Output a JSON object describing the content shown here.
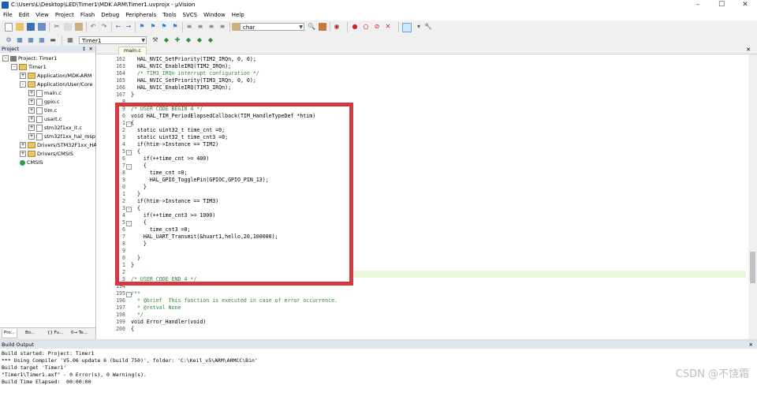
{
  "window": {
    "title": "C:\\Users\\L\\Desktop\\LED\\Timer1\\MDK ARM\\Timer1.uvprojx - µVision"
  },
  "menu": [
    "File",
    "Edit",
    "View",
    "Project",
    "Flash",
    "Debug",
    "Peripherals",
    "Tools",
    "SVCS",
    "Window",
    "Help"
  ],
  "toolbar": {
    "find_value": "char",
    "target_value": "Timer1"
  },
  "project_panel": {
    "header": "Project",
    "tree": [
      {
        "label": "Project: Timer1",
        "indent": 0,
        "kind": "project",
        "toggle": "-"
      },
      {
        "label": "Timer1",
        "indent": 1,
        "kind": "target",
        "toggle": "-"
      },
      {
        "label": "Application/MDK-ARM",
        "indent": 2,
        "kind": "folder",
        "toggle": "+"
      },
      {
        "label": "Application/User/Core",
        "indent": 2,
        "kind": "folder",
        "toggle": "-"
      },
      {
        "label": "main.c",
        "indent": 3,
        "kind": "file",
        "toggle": "+"
      },
      {
        "label": "gpio.c",
        "indent": 3,
        "kind": "file",
        "toggle": "+"
      },
      {
        "label": "tim.c",
        "indent": 3,
        "kind": "file",
        "toggle": "+"
      },
      {
        "label": "usart.c",
        "indent": 3,
        "kind": "file",
        "toggle": "+"
      },
      {
        "label": "stm32f1xx_it.c",
        "indent": 3,
        "kind": "file",
        "toggle": "+"
      },
      {
        "label": "stm32f1xx_hal_msp",
        "indent": 3,
        "kind": "file",
        "toggle": "+"
      },
      {
        "label": "Drivers/STM32F1xx_HAL",
        "indent": 2,
        "kind": "folder",
        "toggle": "+"
      },
      {
        "label": "Drivers/CMSIS",
        "indent": 2,
        "kind": "folder",
        "toggle": "+"
      },
      {
        "label": "CMSIS",
        "indent": 2,
        "kind": "gear",
        "toggle": ""
      }
    ],
    "tabs": [
      "Pro...",
      "Bo...",
      "{} Fu...",
      "0→ Te..."
    ]
  },
  "editor": {
    "tab": "main.c",
    "lines": [
      {
        "n": "162",
        "code": "  HAL_NVIC_SetPriority(TIM2_IRQn, 0, 0);",
        "cls": ""
      },
      {
        "n": "163",
        "code": "  HAL_NVIC_EnableIRQ(TIM2_IRQn);",
        "cls": ""
      },
      {
        "n": "164",
        "code": "  /* TIM3_IRQn interrupt configuration */",
        "cls": "cmt"
      },
      {
        "n": "165",
        "code": "  HAL_NVIC_SetPriority(TIM3_IRQn, 0, 0);",
        "cls": ""
      },
      {
        "n": "166",
        "code": "  HAL_NVIC_EnableIRQ(TIM3_IRQn);",
        "cls": ""
      },
      {
        "n": "167",
        "code": "}",
        "cls": ""
      },
      {
        "n": "8",
        "code": "",
        "cls": ""
      },
      {
        "n": "9",
        "code": "/* USER CODE BEGIN 4 */",
        "cls": "cmt"
      },
      {
        "n": "0",
        "code": "void HAL_TIM_PeriodElapsedCallback(TIM_HandleTypeDef *htim)",
        "cls": ""
      },
      {
        "n": "1",
        "code": "{",
        "cls": ""
      },
      {
        "n": "2",
        "code": "  static uint32_t time_cnt =0;",
        "cls": ""
      },
      {
        "n": "3",
        "code": "  static uint32_t time_cnt3 =0;",
        "cls": ""
      },
      {
        "n": "4",
        "code": "  if(htim->Instance == TIM2)",
        "cls": ""
      },
      {
        "n": "5",
        "code": "  {",
        "cls": ""
      },
      {
        "n": "6",
        "code": "    if(++time_cnt >= 400)",
        "cls": ""
      },
      {
        "n": "7",
        "code": "    {",
        "cls": ""
      },
      {
        "n": "8",
        "code": "      time_cnt =0;",
        "cls": ""
      },
      {
        "n": "9",
        "code": "      HAL_GPIO_TogglePin(GPIOC,GPIO_PIN_13);",
        "cls": ""
      },
      {
        "n": "0",
        "code": "    }",
        "cls": ""
      },
      {
        "n": "1",
        "code": "  }",
        "cls": ""
      },
      {
        "n": "2",
        "code": "  if(htim->Instance == TIM3)",
        "cls": ""
      },
      {
        "n": "3",
        "code": "  {",
        "cls": ""
      },
      {
        "n": "4",
        "code": "    if(++time_cnt3 >= 1000)",
        "cls": ""
      },
      {
        "n": "5",
        "code": "    {",
        "cls": ""
      },
      {
        "n": "6",
        "code": "      time_cnt3 =0;",
        "cls": ""
      },
      {
        "n": "7",
        "code": "    HAL_UART_Transmit(&huart1,hello,20,100000);",
        "cls": ""
      },
      {
        "n": "8",
        "code": "    }",
        "cls": ""
      },
      {
        "n": "9",
        "code": "",
        "cls": ""
      },
      {
        "n": "0",
        "code": "  }",
        "cls": ""
      },
      {
        "n": "1",
        "code": "}",
        "cls": ""
      },
      {
        "n": "2",
        "code": "",
        "cls": ""
      },
      {
        "n": "3",
        "code": "/* USER CODE END 4 */",
        "cls": "cmt"
      },
      {
        "n": "194",
        "code": "",
        "cls": ""
      },
      {
        "n": "195",
        "code": "/**",
        "cls": "cmt"
      },
      {
        "n": "196",
        "code": "  * @brief  This function is executed in case of error occurrence.",
        "cls": "cmt"
      },
      {
        "n": "197",
        "code": "  * @retval None",
        "cls": "cmt"
      },
      {
        "n": "198",
        "code": "  */",
        "cls": "cmt"
      },
      {
        "n": "199",
        "code": "void Error_Handler(void)",
        "cls": ""
      },
      {
        "n": "200",
        "code": "{",
        "cls": ""
      }
    ]
  },
  "build_output": {
    "header": "Build Output",
    "lines": [
      "Build started: Project: Timer1",
      "*** Using Compiler 'V5.06 update 6 (build 750)', folder: 'C:\\Keil_v5\\ARM\\ARMCC\\Bin'",
      "Build target 'Timer1'",
      "\"Timer1\\Timer1.axf\" - 0 Error(s), 0 Warning(s).",
      "Build Time Elapsed:  00:00:00"
    ]
  },
  "watermark": "CSDN @不饶霜"
}
